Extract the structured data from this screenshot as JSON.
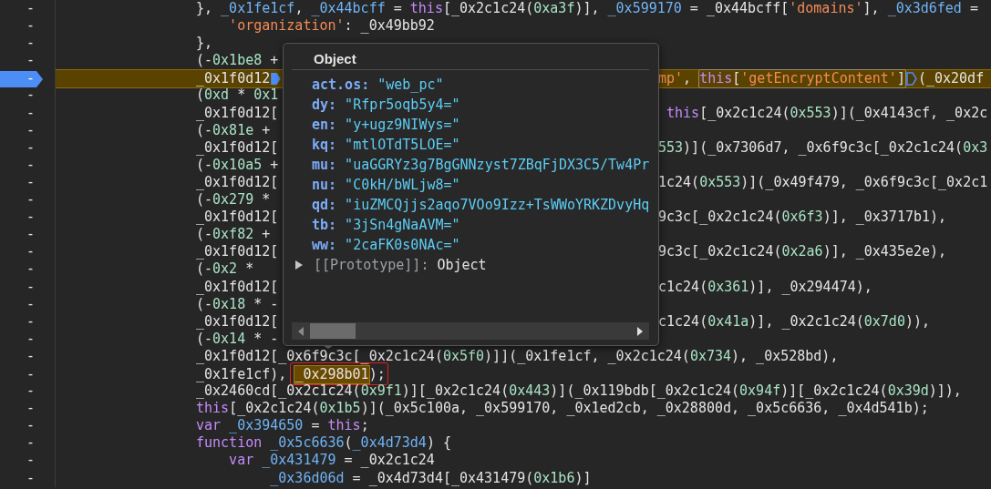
{
  "lines": [
    {
      "gutter": "-",
      "current": false,
      "segments": [
        {
          "kind": "code",
          "tokens": [
            {
              "kind": "plain",
              "text": "}, "
            },
            {
              "kind": "variable",
              "text": "_0x1fe1cf"
            },
            {
              "kind": "plain",
              "text": ", "
            },
            {
              "kind": "variable",
              "text": "_0x44bcff"
            },
            {
              "kind": "plain",
              "text": " = "
            },
            {
              "kind": "keyword",
              "text": "this"
            },
            {
              "kind": "plain",
              "text": "[_0x2c1c24("
            },
            {
              "kind": "number",
              "text": "0xa3f"
            },
            {
              "kind": "plain",
              "text": ")], "
            },
            {
              "kind": "variable",
              "text": "_0x599170"
            },
            {
              "kind": "plain",
              "text": " = _0x44bcff["
            },
            {
              "kind": "string",
              "text": "'domains'"
            },
            {
              "kind": "plain",
              "text": "], "
            },
            {
              "kind": "variable",
              "text": "_0x3d6fed"
            },
            {
              "kind": "plain",
              "text": " ="
            }
          ]
        }
      ]
    },
    {
      "gutter": "-",
      "current": false,
      "segments": [
        {
          "kind": "code",
          "tokens": [
            {
              "kind": "string",
              "text": "    'organization'"
            },
            {
              "kind": "plain",
              "text": ": _0x49bb92"
            }
          ]
        }
      ]
    },
    {
      "gutter": "-",
      "current": false,
      "segments": [
        {
          "kind": "code",
          "tokens": [
            {
              "kind": "plain",
              "text": "},"
            }
          ]
        }
      ]
    },
    {
      "gutter": "-",
      "current": false,
      "segments": [
        {
          "kind": "code",
          "tokens": [
            {
              "kind": "plain",
              "text": "(-"
            },
            {
              "kind": "number",
              "text": "0x1be8"
            },
            {
              "kind": "plain",
              "text": " +"
            }
          ]
        }
      ]
    },
    {
      "gutter": "-",
      "current": true,
      "segments": [
        {
          "kind": "code",
          "tokens": [
            {
              "kind": "plain",
              "text": "_0x1f0d12"
            }
          ]
        },
        {
          "kind": "marker",
          "active": true
        },
        {
          "kind": "covered"
        },
        {
          "kind": "code",
          "tokens": [
            {
              "kind": "string",
              "text": "mp'"
            },
            {
              "kind": "plain",
              "text": ", "
            }
          ]
        },
        {
          "kind": "boxed",
          "tokens": [
            {
              "kind": "keyword",
              "text": "this"
            },
            {
              "kind": "plain",
              "text": "["
            },
            {
              "kind": "string",
              "text": "'getEncryptContent'"
            },
            {
              "kind": "plain",
              "text": "]"
            }
          ]
        },
        {
          "kind": "marker",
          "active": false
        },
        {
          "kind": "code",
          "tokens": [
            {
              "kind": "plain",
              "text": "(_0x20df"
            }
          ]
        }
      ]
    },
    {
      "gutter": "-",
      "current": false,
      "segments": [
        {
          "kind": "code",
          "tokens": [
            {
              "kind": "plain",
              "text": "("
            },
            {
              "kind": "number",
              "text": "0xd"
            },
            {
              "kind": "plain",
              "text": " * "
            },
            {
              "kind": "number",
              "text": "0x1"
            }
          ]
        }
      ]
    },
    {
      "gutter": "-",
      "current": false,
      "segments": [
        {
          "kind": "code",
          "tokens": [
            {
              "kind": "plain",
              "text": "_0x1f0d12["
            }
          ]
        },
        {
          "kind": "covered"
        },
        {
          "kind": "code",
          "tokens": [
            {
              "kind": "keyword",
              "text": " this"
            },
            {
              "kind": "plain",
              "text": "[_0x2c1c24("
            },
            {
              "kind": "number",
              "text": "0x553"
            },
            {
              "kind": "plain",
              "text": ")](_0x4143cf, _0x2c"
            }
          ]
        }
      ]
    },
    {
      "gutter": "-",
      "current": false,
      "segments": [
        {
          "kind": "code",
          "tokens": [
            {
              "kind": "plain",
              "text": "(-"
            },
            {
              "kind": "number",
              "text": "0x81e"
            },
            {
              "kind": "plain",
              "text": " +"
            }
          ]
        }
      ]
    },
    {
      "gutter": "-",
      "current": false,
      "segments": [
        {
          "kind": "code",
          "tokens": [
            {
              "kind": "plain",
              "text": "_0x1f0d12["
            }
          ]
        },
        {
          "kind": "covered"
        },
        {
          "kind": "code",
          "tokens": [
            {
              "kind": "number",
              "text": "553"
            },
            {
              "kind": "plain",
              "text": ")](_0x7306d7, _0x6f9c3c[_0x2c1c24("
            },
            {
              "kind": "number",
              "text": "0x3"
            }
          ]
        }
      ]
    },
    {
      "gutter": "-",
      "current": false,
      "segments": [
        {
          "kind": "code",
          "tokens": [
            {
              "kind": "plain",
              "text": "(-"
            },
            {
              "kind": "number",
              "text": "0x10a5"
            },
            {
              "kind": "plain",
              "text": " +"
            }
          ]
        }
      ]
    },
    {
      "gutter": "-",
      "current": false,
      "segments": [
        {
          "kind": "code",
          "tokens": [
            {
              "kind": "plain",
              "text": "_0x1f0d12["
            }
          ]
        },
        {
          "kind": "covered"
        },
        {
          "kind": "code",
          "tokens": [
            {
              "kind": "plain",
              "text": "1c24("
            },
            {
              "kind": "number",
              "text": "0x553"
            },
            {
              "kind": "plain",
              "text": ")](_0x49f479, _0x6f9c3c[_0x2c1"
            }
          ]
        }
      ]
    },
    {
      "gutter": "-",
      "current": false,
      "segments": [
        {
          "kind": "code",
          "tokens": [
            {
              "kind": "plain",
              "text": "(-"
            },
            {
              "kind": "number",
              "text": "0x279"
            },
            {
              "kind": "plain",
              "text": " *"
            }
          ]
        }
      ]
    },
    {
      "gutter": "-",
      "current": false,
      "segments": [
        {
          "kind": "code",
          "tokens": [
            {
              "kind": "plain",
              "text": "_0x1f0d12["
            }
          ]
        },
        {
          "kind": "covered"
        },
        {
          "kind": "code",
          "tokens": [
            {
              "kind": "plain",
              "text": "9c3c[_0x2c1c24("
            },
            {
              "kind": "number",
              "text": "0x6f3"
            },
            {
              "kind": "plain",
              "text": ")], _0x3717b1),"
            }
          ]
        }
      ]
    },
    {
      "gutter": "-",
      "current": false,
      "segments": [
        {
          "kind": "code",
          "tokens": [
            {
              "kind": "plain",
              "text": "(-"
            },
            {
              "kind": "number",
              "text": "0xf82"
            },
            {
              "kind": "plain",
              "text": " +"
            }
          ]
        }
      ]
    },
    {
      "gutter": "-",
      "current": false,
      "segments": [
        {
          "kind": "code",
          "tokens": [
            {
              "kind": "plain",
              "text": "_0x1f0d12["
            }
          ]
        },
        {
          "kind": "covered"
        },
        {
          "kind": "code",
          "tokens": [
            {
              "kind": "plain",
              "text": "9c3c[_0x2c1c24("
            },
            {
              "kind": "number",
              "text": "0x2a6"
            },
            {
              "kind": "plain",
              "text": ")], _0x435e2e),"
            }
          ]
        }
      ]
    },
    {
      "gutter": "-",
      "current": false,
      "segments": [
        {
          "kind": "code",
          "tokens": [
            {
              "kind": "plain",
              "text": "(-"
            },
            {
              "kind": "number",
              "text": "0x2"
            },
            {
              "kind": "plain",
              "text": " *"
            }
          ]
        }
      ]
    },
    {
      "gutter": "-",
      "current": false,
      "segments": [
        {
          "kind": "code",
          "tokens": [
            {
              "kind": "plain",
              "text": "_0x1f0d12["
            }
          ]
        },
        {
          "kind": "covered"
        },
        {
          "kind": "code",
          "tokens": [
            {
              "kind": "plain",
              "text": "c1c24("
            },
            {
              "kind": "number",
              "text": "0x361"
            },
            {
              "kind": "plain",
              "text": ")], _0x294474),"
            }
          ]
        }
      ]
    },
    {
      "gutter": "-",
      "current": false,
      "segments": [
        {
          "kind": "code",
          "tokens": [
            {
              "kind": "plain",
              "text": "(-"
            },
            {
              "kind": "number",
              "text": "0x18"
            },
            {
              "kind": "plain",
              "text": " * -"
            }
          ]
        }
      ]
    },
    {
      "gutter": "-",
      "current": false,
      "segments": [
        {
          "kind": "code",
          "tokens": [
            {
              "kind": "plain",
              "text": "_0x1f0d12["
            }
          ]
        },
        {
          "kind": "covered"
        },
        {
          "kind": "code",
          "tokens": [
            {
              "kind": "plain",
              "text": "c1c24("
            },
            {
              "kind": "number",
              "text": "0x41a"
            },
            {
              "kind": "plain",
              "text": ")], _0x2c1c24("
            },
            {
              "kind": "number",
              "text": "0x7d0"
            },
            {
              "kind": "plain",
              "text": ")),"
            }
          ]
        }
      ]
    },
    {
      "gutter": "-",
      "current": false,
      "segments": [
        {
          "kind": "code",
          "tokens": [
            {
              "kind": "plain",
              "text": "(-"
            },
            {
              "kind": "number",
              "text": "0x14"
            },
            {
              "kind": "plain",
              "text": " * -"
            }
          ]
        }
      ]
    },
    {
      "gutter": "-",
      "current": false,
      "segments": [
        {
          "kind": "code",
          "tokens": [
            {
              "kind": "plain",
              "text": "_0x1f0d12[_0x6f9c3c[_0x2c1c24("
            },
            {
              "kind": "number",
              "text": "0x5f0"
            },
            {
              "kind": "plain",
              "text": ")]](_0x1fe1cf, _0x2c1c24("
            },
            {
              "kind": "number",
              "text": "0x734"
            },
            {
              "kind": "plain",
              "text": "), _0x528bd),"
            }
          ]
        }
      ]
    },
    {
      "gutter": "-",
      "current": false,
      "segments": [
        {
          "kind": "code",
          "tokens": [
            {
              "kind": "plain",
              "text": "_0x1fe1cf), "
            }
          ]
        },
        {
          "kind": "marked",
          "tokens": [
            {
              "kind": "plain",
              "text": "_0x298b01"
            }
          ]
        },
        {
          "kind": "code",
          "tokens": [
            {
              "kind": "plain",
              "text": ");"
            }
          ]
        }
      ]
    },
    {
      "gutter": "-",
      "current": false,
      "segments": [
        {
          "kind": "code",
          "tokens": [
            {
              "kind": "plain",
              "text": "_0x2460cd[_0x2c1c24("
            },
            {
              "kind": "number",
              "text": "0x9f1"
            },
            {
              "kind": "plain",
              "text": ")][_0x2c1c24("
            },
            {
              "kind": "number",
              "text": "0x443"
            },
            {
              "kind": "plain",
              "text": ")](_0x119bdb[_0x2c1c24("
            },
            {
              "kind": "number",
              "text": "0x94f"
            },
            {
              "kind": "plain",
              "text": ")][_0x2c1c24("
            },
            {
              "kind": "number",
              "text": "0x39d"
            },
            {
              "kind": "plain",
              "text": ")]),"
            }
          ]
        }
      ]
    },
    {
      "gutter": "-",
      "current": false,
      "segments": [
        {
          "kind": "code",
          "tokens": [
            {
              "kind": "keyword",
              "text": "this"
            },
            {
              "kind": "plain",
              "text": "[_0x2c1c24("
            },
            {
              "kind": "number",
              "text": "0x1b5"
            },
            {
              "kind": "plain",
              "text": ")](_0x5c100a, _0x599170, _0x1ed2cb, _0x28800d, _0x5c6636, _0x4d541b);"
            }
          ]
        }
      ]
    },
    {
      "gutter": "-",
      "current": false,
      "segments": [
        {
          "kind": "code",
          "tokens": [
            {
              "kind": "keyword",
              "text": "var"
            },
            {
              "kind": "variable",
              "text": " _0x394650"
            },
            {
              "kind": "plain",
              "text": " = "
            },
            {
              "kind": "keyword",
              "text": "this"
            },
            {
              "kind": "plain",
              "text": ";"
            }
          ]
        }
      ]
    },
    {
      "gutter": "-",
      "current": false,
      "segments": [
        {
          "kind": "code",
          "tokens": [
            {
              "kind": "keyword",
              "text": "function"
            },
            {
              "kind": "variable",
              "text": " _0x5c6636"
            },
            {
              "kind": "plain",
              "text": "("
            },
            {
              "kind": "variable",
              "text": "_0x4d73d4"
            },
            {
              "kind": "plain",
              "text": ") {"
            }
          ]
        }
      ]
    },
    {
      "gutter": "-",
      "current": false,
      "segments": [
        {
          "kind": "code",
          "tokens": [
            {
              "kind": "keyword",
              "text": "    var"
            },
            {
              "kind": "variable",
              "text": " _0x431479"
            },
            {
              "kind": "plain",
              "text": " = _0x2c1c24"
            }
          ]
        }
      ]
    },
    {
      "gutter": "-",
      "current": false,
      "segments": [
        {
          "kind": "code",
          "tokens": [
            {
              "kind": "variable",
              "text": "         _0x36d06d"
            },
            {
              "kind": "plain",
              "text": " = _0x4d73d4[_0x431479("
            },
            {
              "kind": "number",
              "text": "0x1b6"
            },
            {
              "kind": "plain",
              "text": ")]"
            }
          ]
        }
      ]
    }
  ],
  "popover": {
    "title": "Object",
    "properties": [
      {
        "key": "act.os:",
        "value": "\"web_pc\""
      },
      {
        "key": "dy:",
        "value": "\"Rfpr5oqb5y4=\""
      },
      {
        "key": "en:",
        "value": "\"y+ugz9NIWys=\""
      },
      {
        "key": "kq:",
        "value": "\"mtlOTdT5LOE=\""
      },
      {
        "key": "mu:",
        "value": "\"uaGGRYz3g7BgGNNzyst7ZBqFjDX3C5/Tw4Pr"
      },
      {
        "key": "nu:",
        "value": "\"C0kH/bWLjw8=\""
      },
      {
        "key": "qd:",
        "value": "\"iuZMCQjjs2aqo7VOo9Izz+TsWWoYRKZDvyHq"
      },
      {
        "key": "tb:",
        "value": "\"3jSn4gNaAVM=\""
      },
      {
        "key": "ww:",
        "value": "\"2caFK0s0NAc=\""
      }
    ],
    "prototype": {
      "key": "[[Prototype]]:",
      "value": "Object",
      "expanded": false
    }
  }
}
